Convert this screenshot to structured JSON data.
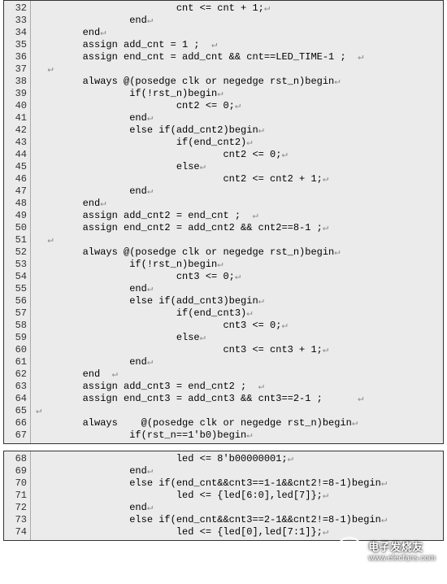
{
  "blocks": [
    {
      "start": 32,
      "lines": [
        "                        cnt <= cnt + 1;↵",
        "                end↵",
        "        end↵",
        "        assign add_cnt = 1 ;  ↵",
        "        assign end_cnt = add_cnt && cnt==LED_TIME-1 ;  ↵",
        "  ↵",
        "        always @(posedge clk or negedge rst_n)begin↵",
        "                if(!rst_n)begin↵",
        "                        cnt2 <= 0;↵",
        "                end↵",
        "                else if(add_cnt2)begin↵",
        "                        if(end_cnt2)↵",
        "                                cnt2 <= 0;↵",
        "                        else↵",
        "                                cnt2 <= cnt2 + 1;↵",
        "                end↵",
        "        end↵",
        "        assign add_cnt2 = end_cnt ;  ↵",
        "        assign end_cnt2 = add_cnt2 && cnt2==8-1 ;↵",
        "  ↵",
        "        always @(posedge clk or negedge rst_n)begin↵",
        "                if(!rst_n)begin↵",
        "                        cnt3 <= 0;↵",
        "                end↵",
        "                else if(add_cnt3)begin↵",
        "                        if(end_cnt3)↵",
        "                                cnt3 <= 0;↵",
        "                        else↵",
        "                                cnt3 <= cnt3 + 1;↵",
        "                end↵",
        "        end  ↵",
        "        assign add_cnt3 = end_cnt2 ;  ↵",
        "        assign end_cnt3 = add_cnt3 && cnt3==2-1 ;      ↵",
        "↵",
        "        always    @(posedge clk or negedge rst_n)begin↵",
        "                if(rst_n==1'b0)begin↵"
      ]
    },
    {
      "start": 68,
      "lines": [
        "                        led <= 8'b00000001;↵",
        "                end↵",
        "                else if(end_cnt&&cnt3==1-1&&cnt2!=8-1)begin↵",
        "                        led <= {led[6:0],led[7]};↵",
        "                end↵",
        "                else if(end_cnt&&cnt3==2-1&&cnt2!=8-1)begin↵",
        "                        led <= {led[0],led[7:1]};↵"
      ]
    }
  ],
  "watermark": {
    "title": "电子发烧友",
    "url": "www.elecfans.com"
  }
}
